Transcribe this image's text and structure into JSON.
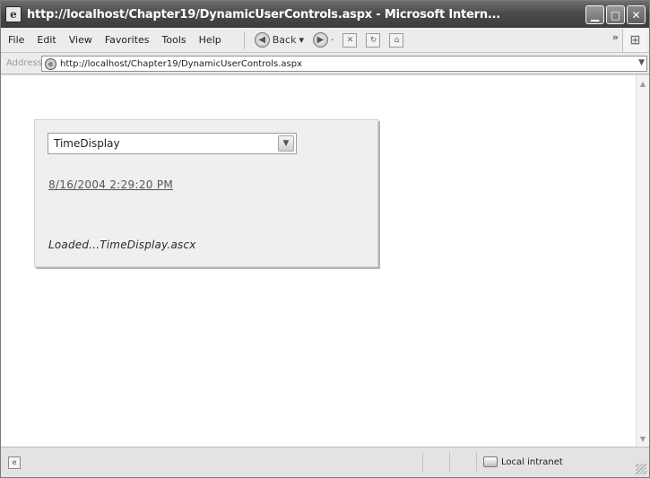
{
  "window": {
    "title": "http://localhost/Chapter19/DynamicUserControls.aspx - Microsoft Intern...",
    "minimize_glyph": "▁",
    "maximize_glyph": "□",
    "close_glyph": "✕"
  },
  "menu": {
    "items": [
      "File",
      "Edit",
      "View",
      "Favorites",
      "Tools",
      "Help"
    ]
  },
  "toolbar": {
    "back_label": "Back",
    "back_arrow": "▾",
    "chevron": "»"
  },
  "address": {
    "label": "Address",
    "url": "http://localhost/Chapter19/DynamicUserControls.aspx"
  },
  "page": {
    "select": {
      "selected": "TimeDisplay"
    },
    "time_link": "8/16/2004 2:29:20 PM",
    "loaded_message": "Loaded...TimeDisplay.ascx"
  },
  "status": {
    "zone": "Local intranet"
  }
}
